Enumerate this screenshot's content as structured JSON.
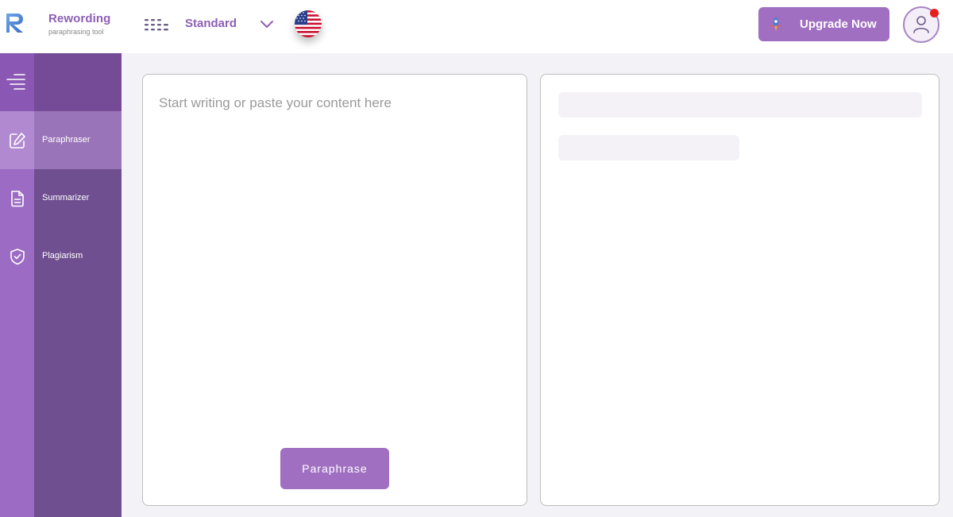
{
  "header": {
    "brand_name": "Rewording",
    "brand_tagline": "paraphrasing tool",
    "mode_label": "Standard",
    "language_flag": "us-flag-icon",
    "upgrade_label": "Upgrade Now"
  },
  "sidebar": {
    "items": [
      {
        "label": "Paraphraser",
        "icon": "edit-icon",
        "active": true
      },
      {
        "label": "Summarizer",
        "icon": "document-icon",
        "active": false
      },
      {
        "label": "Plagiarism",
        "icon": "shield-check-icon",
        "active": false
      }
    ]
  },
  "editor": {
    "placeholder": "Start writing or paste your content here",
    "value": ""
  },
  "actions": {
    "paraphrase_label": "Paraphrase"
  },
  "colors": {
    "accent": "#a06fc2",
    "brand_text": "#8e5fb5",
    "sidebar_panel": "#6f4f90",
    "sidebar_rail": "#9c6cc4",
    "notification_dot": "#e61e1e"
  }
}
